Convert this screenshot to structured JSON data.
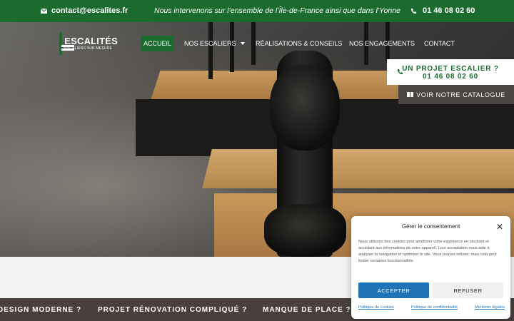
{
  "topbar": {
    "email": "contact@escalites.fr",
    "tagline": "Nous intervenons sur l’ensemble de l’Île-de-France ainsi que dans l’Yonne",
    "phone": "01 46 08 02 60"
  },
  "logo": {
    "name": "ESCALITÉS",
    "subtitle": "ESCALIERS SUR MESURE"
  },
  "nav": {
    "items": [
      {
        "label": "ACCUEIL"
      },
      {
        "label": "NOS ESCALIERS"
      },
      {
        "label": "RÉALISATIONS & CONSEILS"
      },
      {
        "label": "NOS ENGAGEMENTS"
      },
      {
        "label": "CONTACT"
      }
    ]
  },
  "cta": {
    "line1": "UN PROJET ESCALIER ?",
    "line2": "01 46 08 02 60",
    "catalog": "VOIR NOTRE CATALOGUE"
  },
  "ticker": {
    "items": [
      "DESIGN MODERNE ?",
      "PROJET RÉNOVATION COMPLIQUÉ ?",
      "MANQUE DE PLACE ?"
    ]
  },
  "cookie": {
    "title": "Gérer le consentement",
    "body": "Nous utilisons des cookies pour améliorer votre expérience en stockant et accédant aux informations de votre appareil. Leur acceptation nous aide à analyser la navigation et optimiser le site. Vous pouvez refuser, mais cela peut limiter certaines fonctionnalités.",
    "accept": "ACCEPTER",
    "refuse": "REFUSER",
    "links": [
      "Politique de cookies",
      "Politique de confidentialité",
      "Mentions légales"
    ]
  },
  "colors": {
    "brand_green": "#1b6b2e",
    "accept_blue": "#1f73b7",
    "ticker_bg": "#4a3f3d"
  }
}
